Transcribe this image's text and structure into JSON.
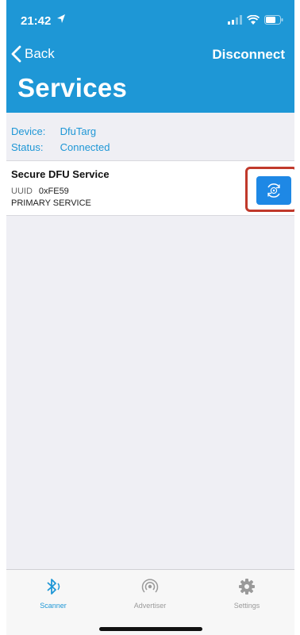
{
  "status_bar": {
    "time": "21:42"
  },
  "nav": {
    "back_label": "Back",
    "disconnect_label": "Disconnect",
    "title": "Services"
  },
  "device": {
    "device_label": "Device:",
    "device_value": "DfuTarg",
    "status_label": "Status:",
    "status_value": "Connected"
  },
  "service": {
    "name": "Secure DFU Service",
    "uuid_label": "UUID",
    "uuid_value": "0xFE59",
    "type": "PRIMARY SERVICE",
    "dfu_button_icon": "dfu-icon"
  },
  "tabs": [
    {
      "label": "Scanner",
      "icon": "bluetooth-icon",
      "active": true
    },
    {
      "label": "Advertiser",
      "icon": "broadcast-icon",
      "active": false
    },
    {
      "label": "Settings",
      "icon": "gear-icon",
      "active": false
    }
  ],
  "colors": {
    "accent": "#1e97d6",
    "highlight_border": "#c0392b",
    "inactive_tab": "#9a9a9a"
  }
}
